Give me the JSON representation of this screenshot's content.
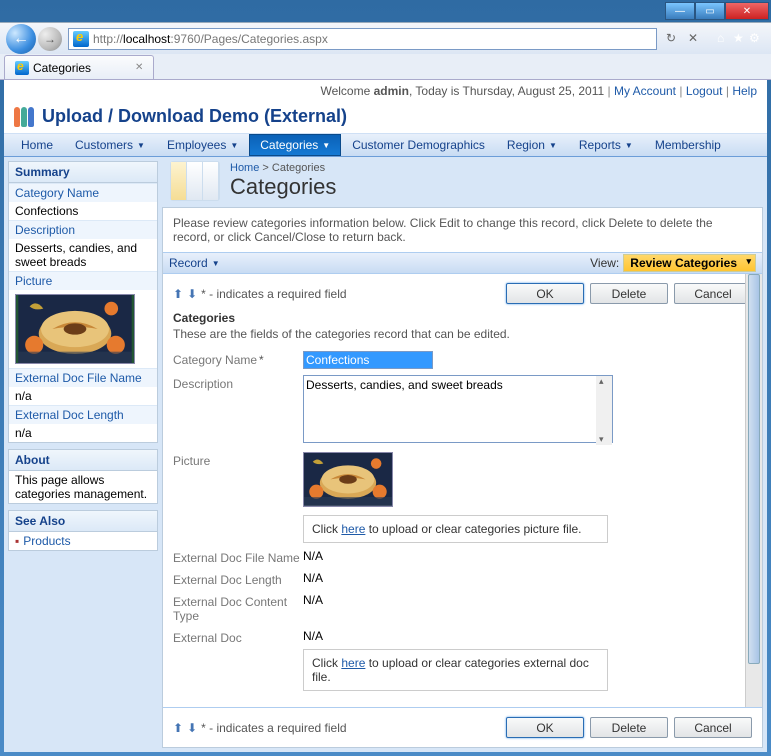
{
  "browser": {
    "url_prefix": "http://",
    "url_host": "localhost",
    "url_port": ":9760",
    "url_path": "/Pages/Categories.aspx",
    "tab_title": "Categories"
  },
  "welcome": {
    "prefix": "Welcome ",
    "user": "admin",
    "date": ", Today is Thursday, August 25, 2011",
    "my_account": "My Account",
    "logout": "Logout",
    "help": "Help"
  },
  "app_title": "Upload / Download Demo (External)",
  "menu": {
    "home": "Home",
    "customers": "Customers",
    "employees": "Employees",
    "categories": "Categories",
    "demographics": "Customer Demographics",
    "region": "Region",
    "reports": "Reports",
    "membership": "Membership"
  },
  "sidebar": {
    "summary": {
      "title": "Summary",
      "cat_name_lbl": "Category Name",
      "cat_name_val": "Confections",
      "desc_lbl": "Description",
      "desc_val": "Desserts, candies, and sweet breads",
      "pic_lbl": "Picture",
      "extfn_lbl": "External Doc File Name",
      "extfn_val": "n/a",
      "extlen_lbl": "External Doc Length",
      "extlen_val": "n/a"
    },
    "about": {
      "title": "About",
      "text": "This page allows categories management."
    },
    "seealso": {
      "title": "See Also",
      "products": "Products"
    }
  },
  "main": {
    "crumb_home": "Home",
    "crumb_current": "Categories",
    "title": "Categories",
    "desc": "Please review categories information below. Click Edit to change this record, click Delete to delete the record, or click Cancel/Close to return back.",
    "record": "Record",
    "view_lbl": "View:",
    "view_val": "Review Categories",
    "required_note": "* - indicates a required field",
    "ok": "OK",
    "delete": "Delete",
    "cancel": "Cancel",
    "section": "Categories",
    "section_desc": "These are the fields of the categories record that can be edited.",
    "fields": {
      "cat_name_lbl": "Category Name",
      "cat_name_val": "Confections",
      "desc_lbl": "Description",
      "desc_val": "Desserts, candies, and sweet breads",
      "pic_lbl": "Picture",
      "pic_upload_pre": "Click ",
      "pic_upload_link": "here",
      "pic_upload_post": " to upload or clear categories picture file.",
      "extfn_lbl": "External Doc File Name",
      "extfn_val": "N/A",
      "extlen_lbl": "External Doc Length",
      "extlen_val": "N/A",
      "extct_lbl": "External Doc Content Type",
      "extct_val": "N/A",
      "extdoc_lbl": "External Doc",
      "extdoc_val": "N/A",
      "extdoc_upload_pre": "Click ",
      "extdoc_upload_link": "here",
      "extdoc_upload_post": " to upload or clear categories external doc file."
    }
  }
}
